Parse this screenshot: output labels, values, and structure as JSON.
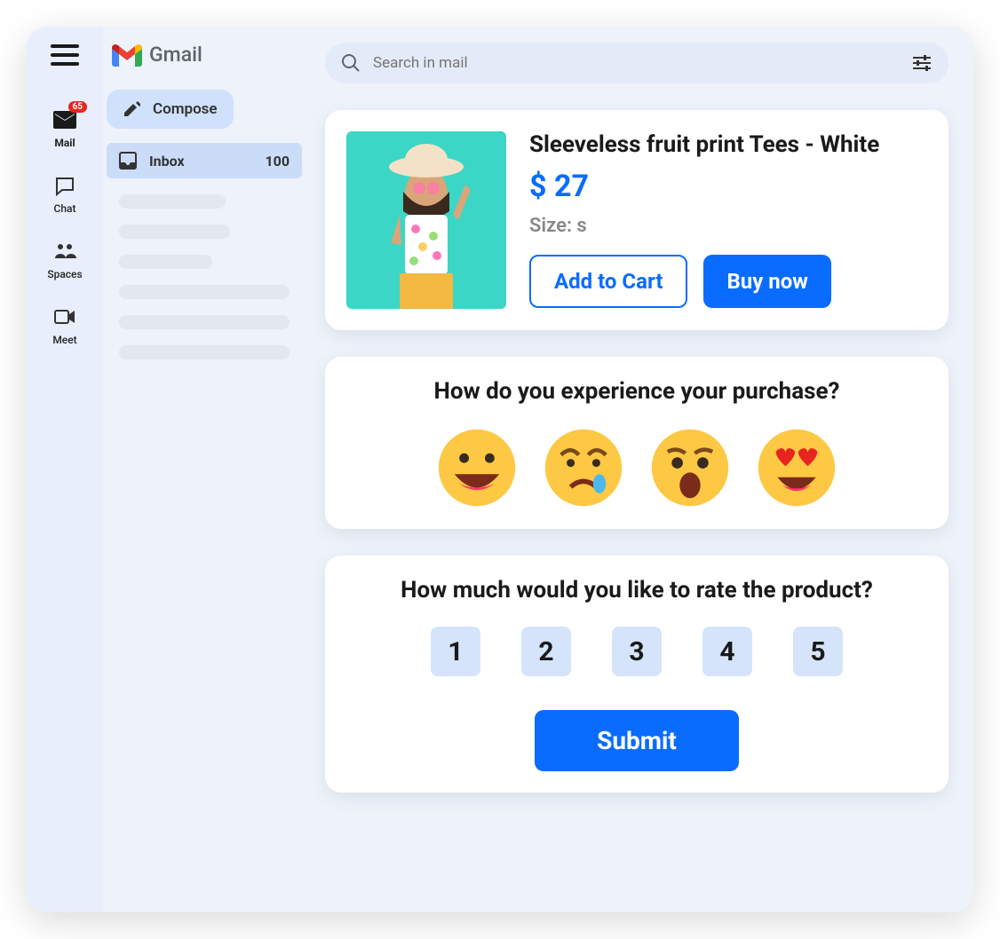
{
  "header": {
    "app_name": "Gmail",
    "search_placeholder": "Search in mail"
  },
  "rail": {
    "mail": {
      "label": "Mail",
      "badge": "65"
    },
    "chat": {
      "label": "Chat"
    },
    "spaces": {
      "label": "Spaces"
    },
    "meet": {
      "label": "Meet"
    }
  },
  "sidebar": {
    "compose_label": "Compose",
    "inbox_label": "Inbox",
    "inbox_count": "100"
  },
  "product": {
    "title": "Sleeveless fruit print Tees - White",
    "price": "$ 27",
    "size_label": "Size: s",
    "add_to_cart": "Add to Cart",
    "buy_now": "Buy now"
  },
  "survey1": {
    "question": "How do you experience your purchase?",
    "emojis": [
      "happy",
      "sad-tear",
      "worried",
      "heart-eyes"
    ]
  },
  "survey2": {
    "question": "How much would you like to rate the product?",
    "options": [
      "1",
      "2",
      "3",
      "4",
      "5"
    ],
    "submit_label": "Submit"
  }
}
